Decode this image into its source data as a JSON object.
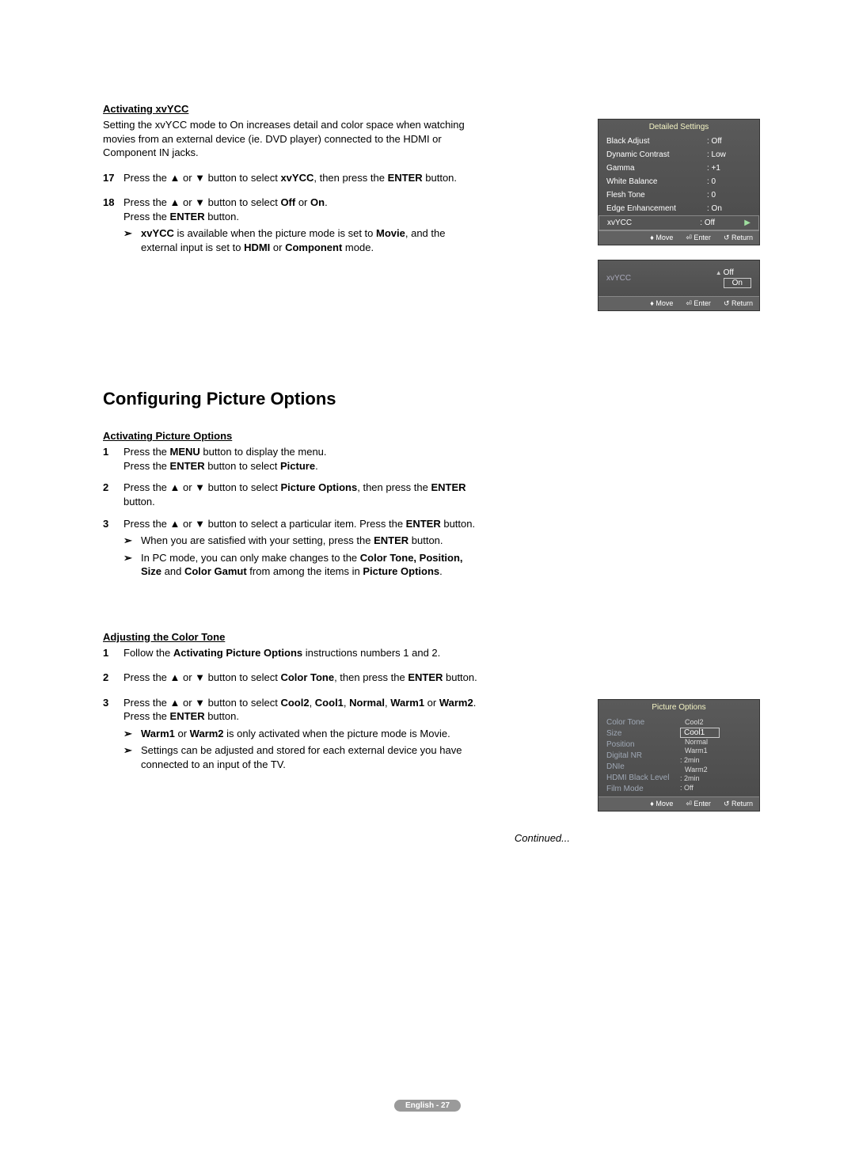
{
  "s1": {
    "title": "Activating xvYCC",
    "intro": "Setting the xvYCC mode to On increases detail and color space when watching movies from an external device (ie. DVD player) connected to the HDMI or Component IN jacks.",
    "step17_pre": "Press the ▲ or ▼ button to select ",
    "step17_b1": "xvYCC",
    "step17_mid": ", then press the ",
    "step17_b2": "ENTER",
    "step17_post": " button.",
    "step18_pre": "Press the ▲ or ▼ button to select ",
    "step18_b1": "Off",
    "step18_or": " or ",
    "step18_b2": "On",
    "step18_post": ".",
    "step18_l2a": "Press the ",
    "step18_l2b": "ENTER",
    "step18_l2c": " button.",
    "note_b1": "xvYCC",
    "note_t1": " is available when the picture mode is set to ",
    "note_b2": "Movie",
    "note_t2": ", and the external input is set to ",
    "note_b3": "HDMI",
    "note_t3": " or ",
    "note_b4": "Component",
    "note_t4": " mode."
  },
  "heading2": "Configuring Picture Options",
  "s2": {
    "title": "Activating Picture Options",
    "step1a": "Press the ",
    "step1b": "MENU",
    "step1c": " button to display the menu.",
    "step1l2a": "Press the ",
    "step1l2b": "ENTER",
    "step1l2c": " button to select ",
    "step1l2d": "Picture",
    "step1l2e": ".",
    "step2a": "Press the ▲ or ▼ button to select ",
    "step2b": "Picture Options",
    "step2c": ", then press the ",
    "step2d": "ENTER",
    "step2e": " button.",
    "step3a": "Press the ▲ or ▼ button to select a particular item. Press the ",
    "step3b": "ENTER",
    "step3c": " button.",
    "n1a": "When you are satisfied with your setting, press the ",
    "n1b": "ENTER",
    "n1c": " button.",
    "n2a": "In PC mode, you can only make changes to the ",
    "n2b": "Color Tone, Position, Size",
    "n2c": " and ",
    "n2d": "Color Gamut",
    "n2e": " from among the items in ",
    "n2f": "Picture Options",
    "n2g": "."
  },
  "s3": {
    "title": "Adjusting the Color Tone",
    "step1a": "Follow the ",
    "step1b": "Activating Picture Options",
    "step1c": " instructions numbers 1 and 2.",
    "step2a": "Press the ▲ or ▼ button to select ",
    "step2b": "Color Tone",
    "step2c": ", then press the ",
    "step2d": "ENTER",
    "step2e": " button.",
    "step3a": "Press the ▲ or ▼ button to select ",
    "step3b": "Cool2",
    "step3c": ", ",
    "step3d": "Cool1",
    "step3e": ", ",
    "step3f": "Normal",
    "step3g": ", ",
    "step3h": "Warm1",
    "step3i": " or ",
    "step3j": "Warm2",
    "step3k": ".",
    "step3l2a": "Press the ",
    "step3l2b": "ENTER",
    "step3l2c": " button.",
    "n1a": "Warm1",
    "n1b": " or ",
    "n1c": "Warm2",
    "n1d": " is only activated when the picture mode is Movie.",
    "n2": "Settings can be adjusted and stored for each external device you have connected to an input of the TV."
  },
  "continued": "Continued...",
  "pagepill": "English - 27",
  "osd1": {
    "title": "Detailed Settings",
    "rows": [
      {
        "label": "Black Adjust",
        "value": ": Off"
      },
      {
        "label": "Dynamic Contrast",
        "value": ": Low"
      },
      {
        "label": "Gamma",
        "value": ": +1"
      },
      {
        "label": "White Balance",
        "value": ": 0"
      },
      {
        "label": "Flesh Tone",
        "value": ": 0"
      },
      {
        "label": "Edge Enhancement",
        "value": ": On"
      }
    ],
    "hi": {
      "label": "xvYCC",
      "value": ": Off"
    },
    "foot": {
      "move": "Move",
      "enter": "Enter",
      "return": "Return"
    }
  },
  "osd2": {
    "label": "xvYCC",
    "off": "Off",
    "on": "On",
    "foot": {
      "move": "Move",
      "enter": "Enter",
      "return": "Return"
    }
  },
  "osd3": {
    "title": "Picture Options",
    "r1": "Color Tone",
    "r2": "Size",
    "r3": "Position",
    "r4": "Digital NR",
    "r5": "DNIe",
    "r6": "HDMI Black Level",
    "r7": "Film Mode",
    "dd": {
      "cool2": "Cool2",
      "cool1": "Cool1",
      "normal": "Normal",
      "warm1": "Warm1",
      "m2a": ": 2min",
      "warm2": "Warm2",
      "m2b": ": 2min"
    },
    "v7": ": Off",
    "foot": {
      "move": "Move",
      "enter": "Enter",
      "return": "Return"
    }
  }
}
